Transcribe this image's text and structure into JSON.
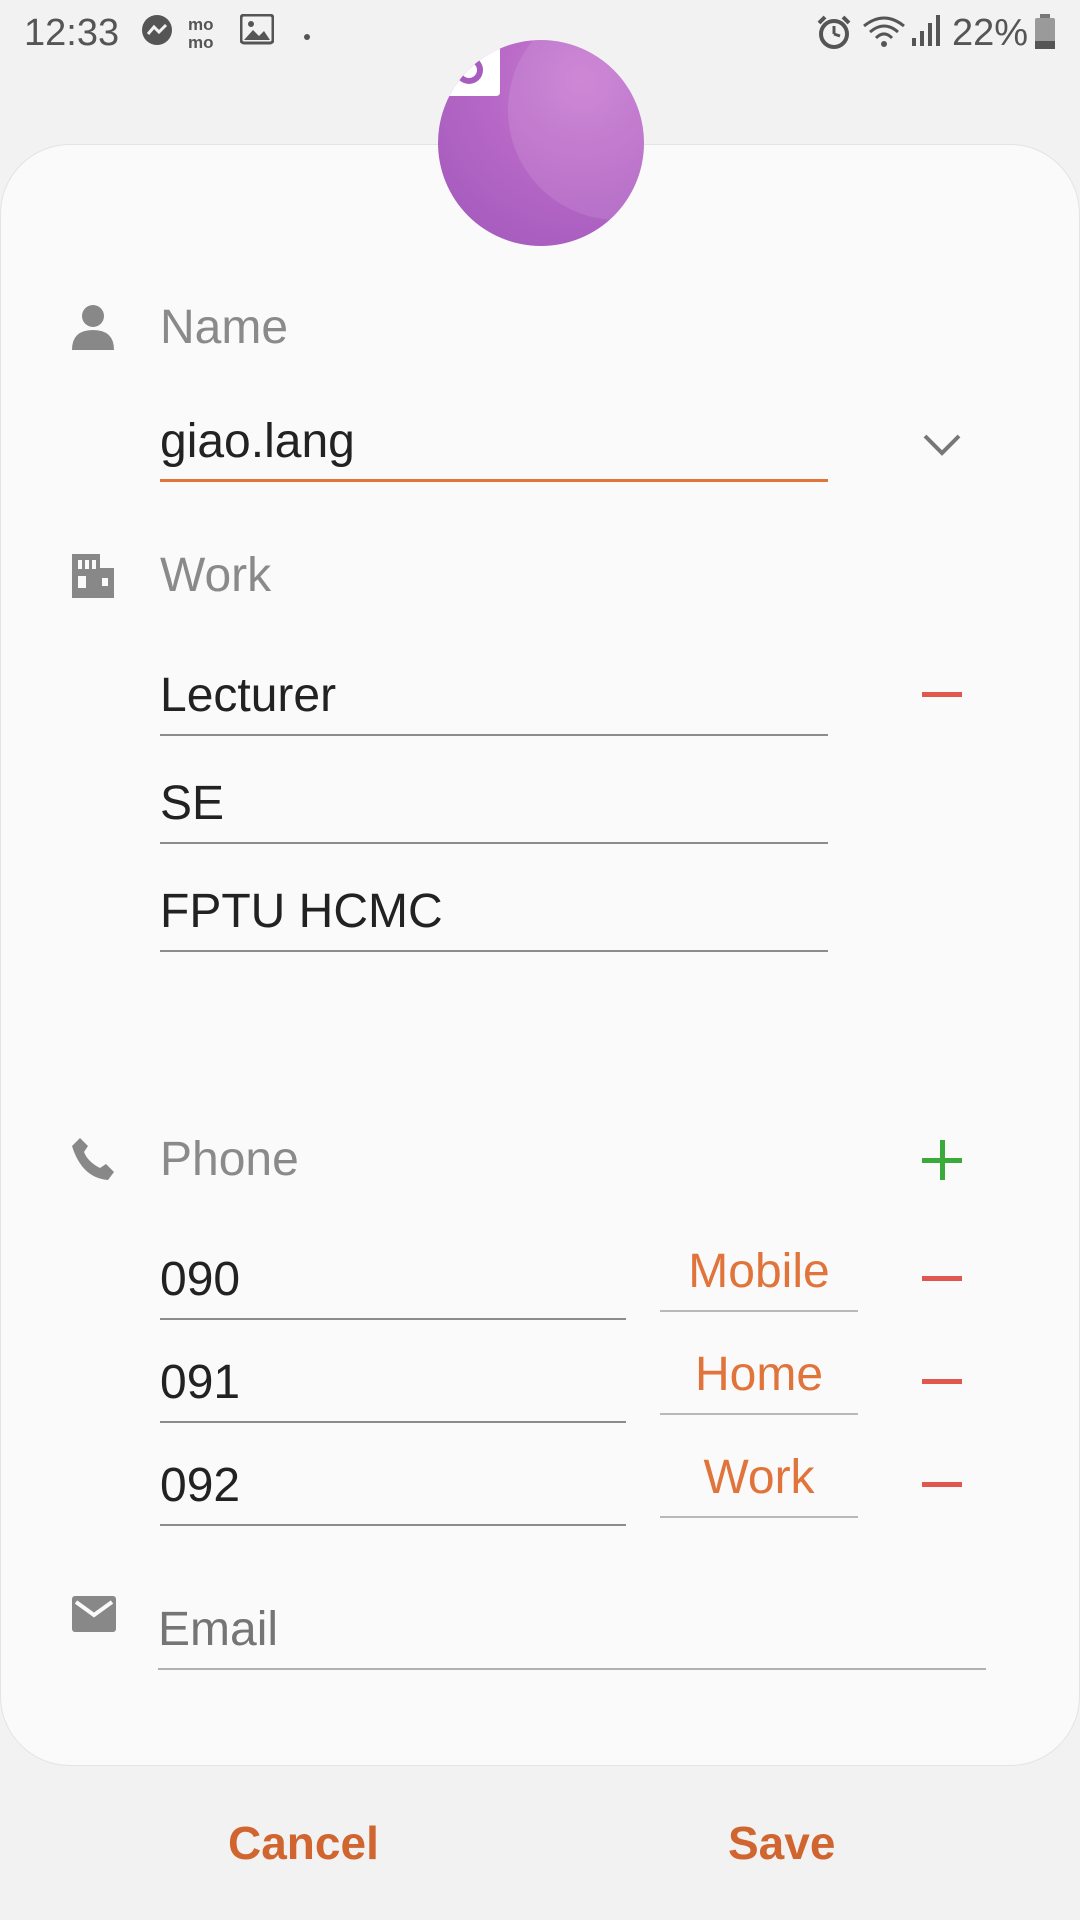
{
  "status_bar": {
    "time": "12:33",
    "notification_icons": [
      "messenger-icon",
      "momo-icon",
      "gallery-icon",
      "dot-icon"
    ],
    "system_icons": [
      "alarm-icon",
      "wifi-icon",
      "signal-icon",
      "battery-icon"
    ],
    "battery_percent": "22%"
  },
  "avatar": {
    "icon": "camera-icon",
    "color": "#b667c6"
  },
  "name_section": {
    "label": "Name",
    "icon": "person-icon",
    "value": "giao.lang"
  },
  "work_section": {
    "label": "Work",
    "icon": "building-icon",
    "fields": [
      "Lecturer",
      "SE",
      "FPTU HCMC"
    ]
  },
  "phone_section": {
    "label": "Phone",
    "icon": "phone-icon",
    "entries": [
      {
        "number": "090",
        "type": "Mobile"
      },
      {
        "number": "091",
        "type": "Home"
      },
      {
        "number": "092",
        "type": "Work"
      }
    ]
  },
  "email_section": {
    "icon": "mail-icon",
    "placeholder": "Email"
  },
  "buttons": {
    "cancel": "Cancel",
    "save": "Save"
  },
  "colors": {
    "accent": "#e0743a",
    "remove": "#e0574e",
    "add": "#3aaa3a",
    "avatar": "#b667c6"
  }
}
